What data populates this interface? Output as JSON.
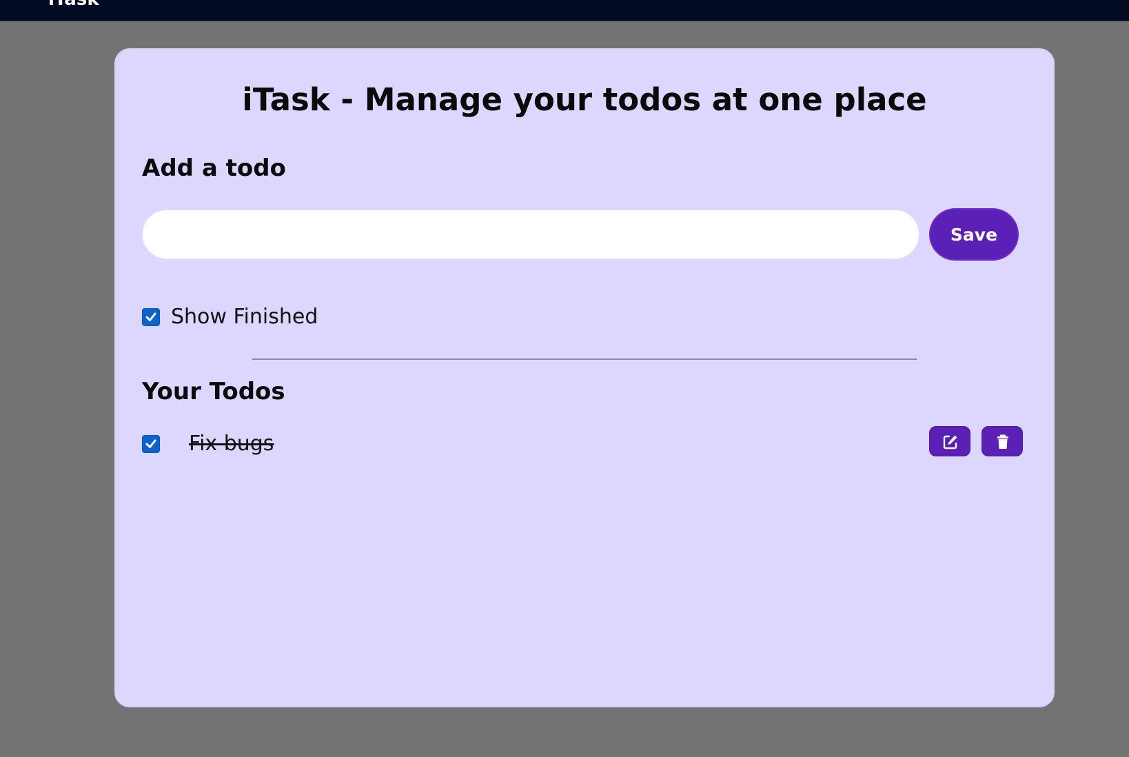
{
  "navbar": {
    "brand": "iTask"
  },
  "card": {
    "title": "iTask - Manage your todos at one place",
    "add_section": {
      "heading": "Add a todo",
      "input_value": "",
      "input_placeholder": "",
      "save_label": "Save"
    },
    "show_finished": {
      "label": "Show Finished",
      "checked": true
    },
    "todos_section": {
      "heading": "Your Todos",
      "items": [
        {
          "text": "Fix bugs",
          "completed": true,
          "edit_icon": "edit-icon",
          "delete_icon": "trash-icon"
        }
      ]
    }
  },
  "colors": {
    "page_background": "#747373",
    "navbar_background": "#020b22",
    "card_background": "#ddd6fe",
    "accent": "#5b21b6",
    "checkbox": "#0b63ce"
  }
}
